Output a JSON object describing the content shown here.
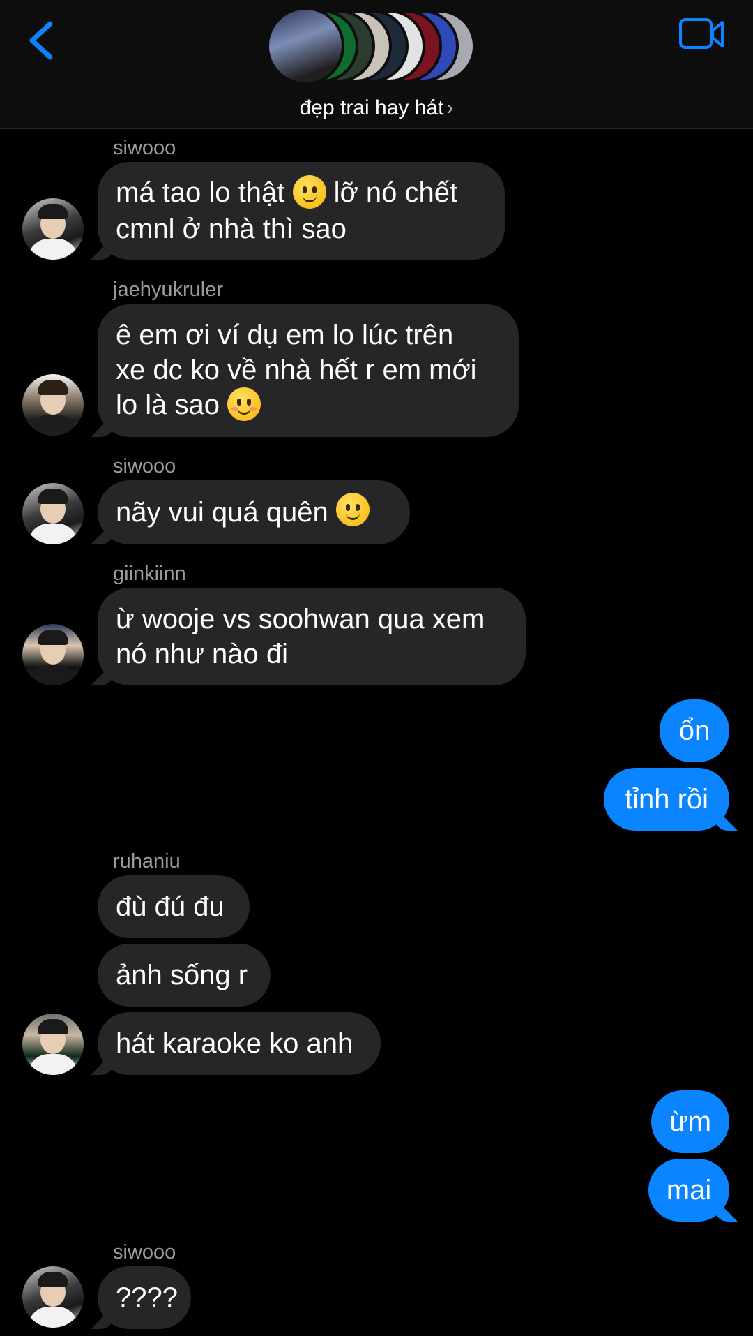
{
  "header": {
    "group_name": "đẹp trai hay hát",
    "chevron": "›",
    "back_icon": "chevron-left-icon",
    "video_icon": "video-camera-icon",
    "accent": "#0a84ff"
  },
  "messages": [
    {
      "sender": "siwooo",
      "lines": [
        "má tao lo thật",
        "lỡ nó chết",
        "cmnl ở nhà thì sao"
      ]
    },
    {
      "sender": "jaehyukruler",
      "lines": [
        "ê em ơi ví dụ em lo lúc trên",
        "xe dc ko về nhà hết r em mới",
        "lo là sao"
      ]
    },
    {
      "sender": "siwooo",
      "lines": [
        "nãy vui quá quên"
      ]
    },
    {
      "sender": "giinkiinn",
      "lines": [
        "ừ wooje vs soohwan qua xem",
        "nó như nào đi"
      ]
    },
    {
      "out": [
        "ổn",
        "tỉnh rồi"
      ]
    },
    {
      "sender": "ruhaniu",
      "lines": [
        "đù đú đu",
        "ảnh sống r",
        "hát karaoke ko anh"
      ]
    },
    {
      "out": [
        "ừm",
        "mai"
      ]
    },
    {
      "sender": "siwooo",
      "lines": [
        "????"
      ]
    }
  ],
  "colors": {
    "incoming_bubble": "#262628",
    "outgoing_bubble": "#0a84ff",
    "sender_name": "#9b9b9f"
  }
}
